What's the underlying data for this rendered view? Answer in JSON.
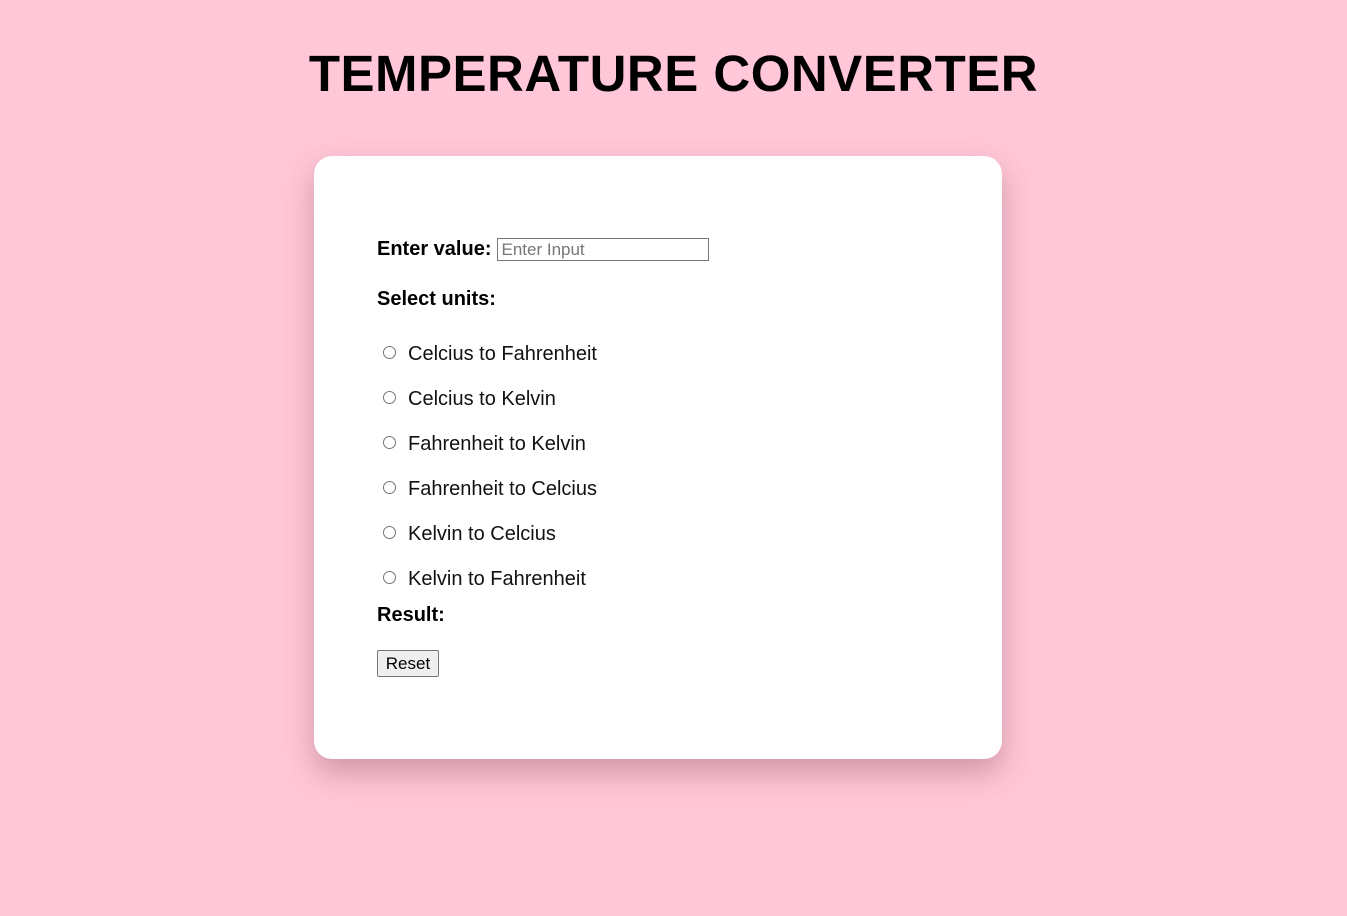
{
  "page": {
    "title": "TEMPERATURE CONVERTER",
    "background_color": "#ffc7d7",
    "card_color": "#ffffff"
  },
  "form": {
    "value_label": "Enter value:",
    "value_input": {
      "value": "",
      "placeholder": "Enter Input"
    },
    "units_label": "Select units:",
    "options": [
      {
        "label": "Celcius to Fahrenheit",
        "selected": false
      },
      {
        "label": "Celcius to Kelvin",
        "selected": false
      },
      {
        "label": "Fahrenheit to Kelvin",
        "selected": false
      },
      {
        "label": "Fahrenheit to Celcius",
        "selected": false
      },
      {
        "label": "Kelvin to Celcius",
        "selected": false
      },
      {
        "label": "Kelvin to Fahrenheit",
        "selected": false
      }
    ],
    "result_label": "Result:",
    "result_value": "",
    "reset_label": "Reset"
  }
}
